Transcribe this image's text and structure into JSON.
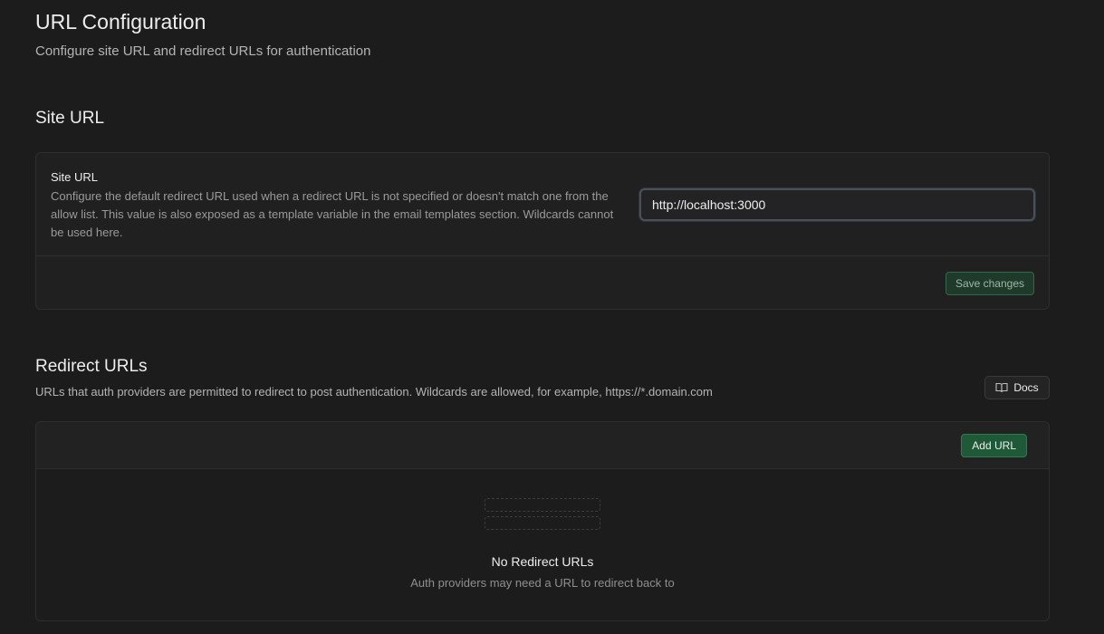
{
  "header": {
    "title": "URL Configuration",
    "subtitle": "Configure site URL and redirect URLs for authentication"
  },
  "site_url": {
    "section_title": "Site URL",
    "field_label": "Site URL",
    "field_description": "Configure the default redirect URL used when a redirect URL is not specified or doesn't match one from the allow list. This value is also exposed as a template variable in the email templates section. Wildcards cannot be used here.",
    "input_value": "http://localhost:3000",
    "save_label": "Save changes"
  },
  "redirect_urls": {
    "section_title": "Redirect URLs",
    "description": "URLs that auth providers are permitted to redirect to post authentication. Wildcards are allowed, for example, https://*.domain.com",
    "docs_label": "Docs",
    "docs_icon": "book-icon",
    "add_label": "Add URL",
    "empty_title": "No Redirect URLs",
    "empty_description": "Auth providers may need a URL to redirect back to"
  },
  "colors": {
    "background": "#1c1c1c",
    "card": "#202020",
    "brand_green": "#1e5a38"
  }
}
